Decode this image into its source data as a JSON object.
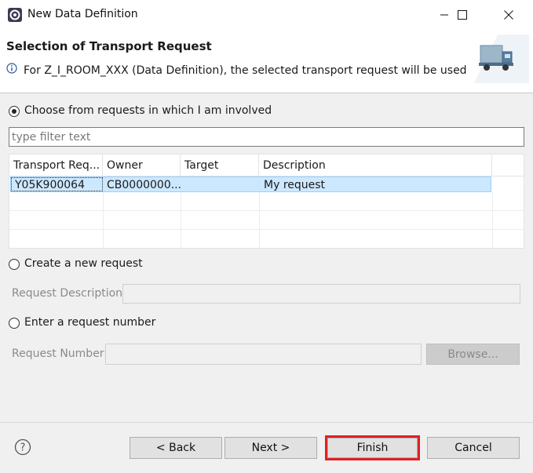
{
  "window": {
    "title": "New Data Definition",
    "minimize_glyph": "—",
    "maximize_glyph": "☐",
    "close_glyph": "✕"
  },
  "header": {
    "title": "Selection of Transport Request",
    "message": "For Z_I_ROOM_XXX (Data Definition), the selected transport request will be used"
  },
  "options": {
    "choose": {
      "label": "Choose from requests in which I am involved",
      "selected": true
    },
    "create": {
      "label": "Create a new request",
      "selected": false
    },
    "enter": {
      "label": "Enter a request number",
      "selected": false
    }
  },
  "filter": {
    "placeholder": "type filter text",
    "value": ""
  },
  "table": {
    "columns": [
      "Transport Req...",
      "Owner",
      "Target",
      "Description"
    ],
    "rows": [
      {
        "transport": "Y05K900064",
        "owner": "CB0000000...",
        "target": "",
        "description": "My request"
      }
    ]
  },
  "create_section": {
    "label": "Request Description:",
    "value": ""
  },
  "enter_section": {
    "label": "Request Number:",
    "value": "",
    "browse": "Browse..."
  },
  "buttons": {
    "help_glyph": "?",
    "back": "< Back",
    "next": "Next >",
    "finish": "Finish",
    "cancel": "Cancel"
  },
  "colors": {
    "selection": "#cce8ff",
    "finish_highlight": "#e02020"
  },
  "icons": [
    "eclipse-app-icon",
    "info-icon",
    "transport-truck-icon",
    "help-icon"
  ]
}
